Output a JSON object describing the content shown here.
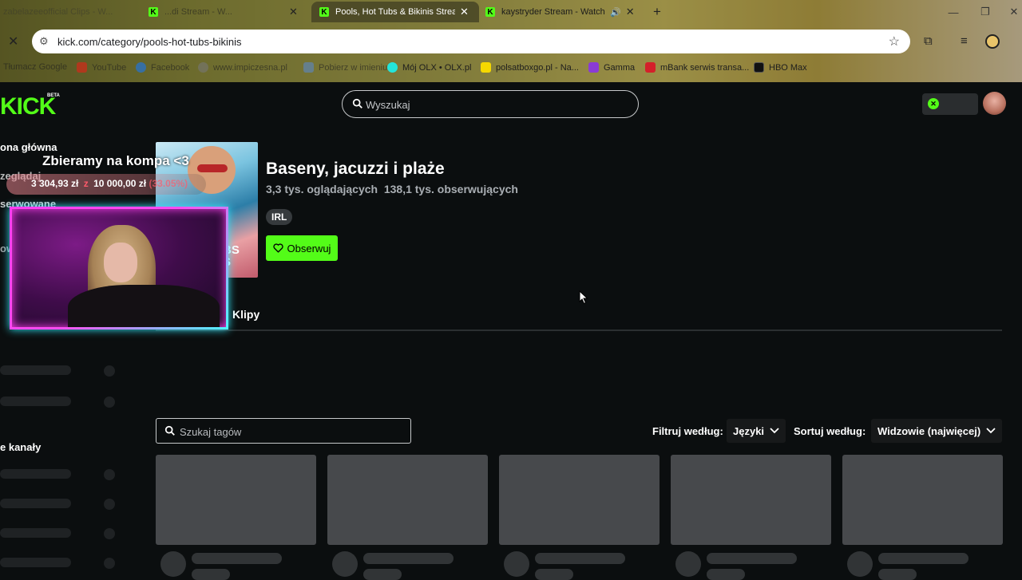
{
  "browser": {
    "tabs": [
      {
        "title": "zabelazeeofficial Clips - W...",
        "active": false
      },
      {
        "title": "...di Stream - W...",
        "active": false
      },
      {
        "title": "Pools, Hot Tubs & Bikinis Stream",
        "active": true
      },
      {
        "title": "kaystryder Stream - Watch L...",
        "active": false
      }
    ],
    "url": "kick.com/category/pools-hot-tubs-bikinis",
    "bookmarks": [
      "Tłumacz Google",
      "YouTube",
      "Facebook",
      "www.impiczesna.pl",
      "Pobierz w imieniu",
      "Mój OLX • OLX.pl",
      "polsatboxgo.pl - Na...",
      "Gamma",
      "mBank serwis transa...",
      "HBO Max"
    ],
    "colors": {
      "accent": "#53fc18"
    }
  },
  "site": {
    "logo": "KICK",
    "beta": "BETA",
    "search_placeholder": "Wyszukaj",
    "nav": {
      "home": "ona główna",
      "browse": "zeglądaj",
      "followed": "serwowane",
      "other": "owe",
      "channels": "e kanały"
    },
    "category": {
      "title": "Baseny, jacuzzi i plaże",
      "stats": "3,3 tys. oglądających  138,1 tys. obserwujących",
      "tag": "IRL",
      "follow_label": "Obserwuj",
      "cover_text": "BS\nS"
    },
    "overlay": {
      "title": "Zbieramy na kompa <3",
      "goal_current": "3 304,93 zł",
      "goal_separator": "z",
      "goal_target": "10 000,00 zł",
      "goal_percent": "(33.05%)"
    },
    "tabs": {
      "clips": "Klipy"
    },
    "tag_search_placeholder": "Szukaj tagów",
    "filter": {
      "filter_label": "Filtruj według:",
      "filter_value": "Języki",
      "sort_label": "Sortuj według:",
      "sort_value": "Widzowie (najwięcej)"
    }
  }
}
